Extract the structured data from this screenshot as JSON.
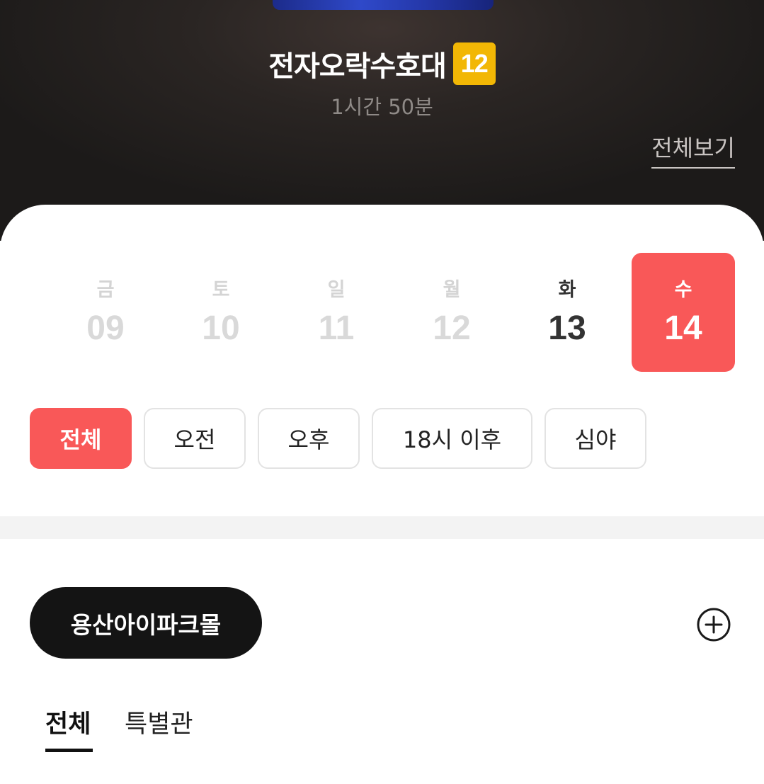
{
  "movie": {
    "title": "전자오락수호대",
    "rating": "12",
    "runtime": "1시간 50분",
    "view_all": "전체보기"
  },
  "dates": [
    {
      "dow": "금",
      "day": "09",
      "state": "disabled"
    },
    {
      "dow": "토",
      "day": "10",
      "state": "disabled"
    },
    {
      "dow": "일",
      "day": "11",
      "state": "disabled"
    },
    {
      "dow": "월",
      "day": "12",
      "state": "disabled"
    },
    {
      "dow": "화",
      "day": "13",
      "state": "enabled"
    },
    {
      "dow": "수",
      "day": "14",
      "state": "selected"
    }
  ],
  "time_filters": [
    {
      "label": "전체",
      "active": true
    },
    {
      "label": "오전",
      "active": false
    },
    {
      "label": "오후",
      "active": false
    },
    {
      "label": "18시 이후",
      "active": false
    },
    {
      "label": "심야",
      "active": false
    }
  ],
  "theater": {
    "name": "용산아이파크몰",
    "add_icon": "plus-circle-icon"
  },
  "hall_tabs": [
    {
      "label": "전체",
      "active": true
    },
    {
      "label": "특별관",
      "active": false
    }
  ],
  "colors": {
    "accent": "#f95858",
    "rating_badge": "#f2b705",
    "header_bg": "#1c1a19",
    "pill_bg": "#141414"
  }
}
